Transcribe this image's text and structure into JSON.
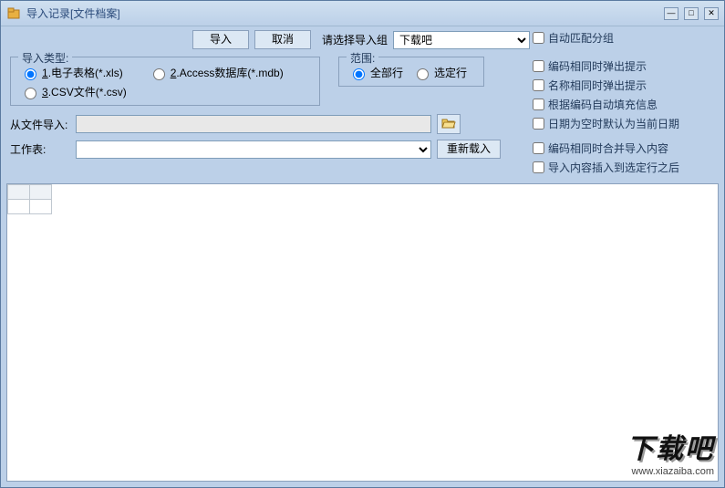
{
  "title": "导入记录[文件档案]",
  "toolbar": {
    "import_btn": "导入",
    "cancel_btn": "取消",
    "select_group_label": "请选择导入组",
    "group_select_value": "下载吧"
  },
  "import_type": {
    "legend": "导入类型:",
    "opt1": "1.电子表格(*.xls)",
    "opt2": "2.Access数据库(*.mdb)",
    "opt3": "3.CSV文件(*.csv)"
  },
  "scope": {
    "legend": "范围:",
    "all_rows": "全部行",
    "selected_rows": "选定行"
  },
  "form": {
    "from_file_label": "从文件导入:",
    "from_file_value": "",
    "sheet_label": "工作表:",
    "sheet_value": "",
    "reload_btn": "重新载入"
  },
  "options": {
    "auto_match_group": "自动匹配分组",
    "code_dup_prompt": "编码相同时弹出提示",
    "name_dup_prompt": "名称相同时弹出提示",
    "auto_fill_by_code": "根据编码自动填充信息",
    "empty_date_default": "日期为空时默认为当前日期",
    "merge_on_same_code": "编码相同时合并导入内容",
    "insert_after_selected": "导入内容插入到选定行之后"
  },
  "watermark": {
    "big": "下载吧",
    "url": "www.xiazaiba.com"
  }
}
